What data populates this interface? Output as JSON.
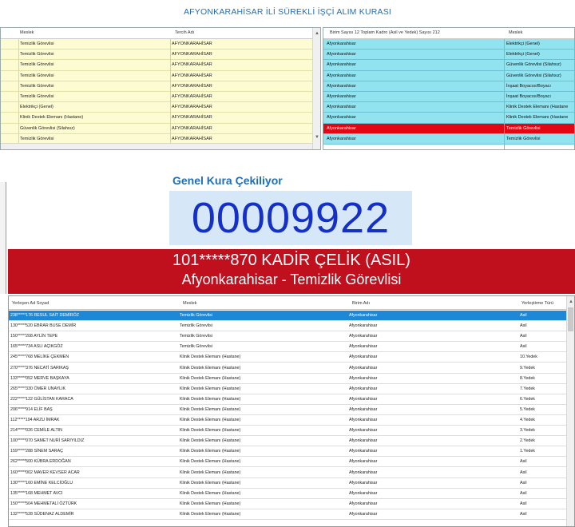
{
  "window_title": "AFYONKARAHİSAR İLİ SÜREKLİ İŞÇİ ALIM KURASI",
  "top_left_grid": {
    "headers": [
      "Meslek",
      "Tercih Adı"
    ],
    "rows": [
      [
        "Temizlik Görevlisi",
        "AFYONKARAHİSAR"
      ],
      [
        "Temizlik Görevlisi",
        "AFYONKARAHİSAR"
      ],
      [
        "Temizlik Görevlisi",
        "AFYONKARAHİSAR"
      ],
      [
        "Temizlik Görevlisi",
        "AFYONKARAHİSAR"
      ],
      [
        "Temizlik Görevlisi",
        "AFYONKARAHİSAR"
      ],
      [
        "Temizlik Görevlisi",
        "AFYONKARAHİSAR"
      ],
      [
        "Elektrikçi (Genel)",
        "AFYONKARAHİSAR"
      ],
      [
        "Klinik Destek Elemanı (Hastane)",
        "AFYONKARAHİSAR"
      ],
      [
        "Güvenlik Görevlisi (Silahsız)",
        "AFYONKARAHİSAR"
      ],
      [
        "Temizlik Görevlisi",
        "AFYONKARAHİSAR"
      ]
    ]
  },
  "top_right_grid": {
    "headers": [
      "Birim Sayısı 12 Toplam Kadro (Asil ve Yedek) Sayısı 212",
      "Meslek"
    ],
    "rows": [
      [
        "Afyonkarahisar",
        "Elektrikçi (Genel)"
      ],
      [
        "Afyonkarahisar",
        "Elektrikçi (Genel)"
      ],
      [
        "Afyonkarahisar",
        "Güvenlik Görevlisi (Silahsız)"
      ],
      [
        "Afyonkarahisar",
        "Güvenlik Görevlisi (Silahsız)"
      ],
      [
        "Afyonkarahisar",
        "İnşaat Boyacısı/Boyacı"
      ],
      [
        "Afyonkarahisar",
        "İnşaat Boyacısı/Boyacı"
      ],
      [
        "Afyonkarahisar",
        "Klinik Destek Elemanı (Hastane"
      ],
      [
        "Afyonkarahisar",
        "Klinik Destek Elemanı (Hastane"
      ],
      [
        "Afyonkarahisar",
        "Temizlik Görevlisi"
      ],
      [
        "Afyonkarahisar",
        "Temizlik Görevlisi"
      ]
    ],
    "highlight_index": 8
  },
  "draw": {
    "label": "Genel Kura Çekiliyor",
    "number": "00009922",
    "winner_line1": "101*****870 KADİR ÇELİK (ASIL)",
    "winner_line2": "Afyonkarahisar - Temizlik Görevlisi"
  },
  "results_grid": {
    "headers": [
      "Yerleşen Ad Soyad",
      "Meslek",
      "Birim Adı",
      "Yerleştirme Türü"
    ],
    "rows": [
      [
        "238*****176 RESUL SAİT DEMİRÖZ",
        "Temizlik Görevlisi",
        "Afyonkarahisar",
        "Asil"
      ],
      [
        "130*****520 EBRAR BUSE DEMİR",
        "Temizlik Görevlisi",
        "Afyonkarahisar",
        "Asil"
      ],
      [
        "150*****208 AYLİN TEPE",
        "Temizlik Görevlisi",
        "Afyonkarahisar",
        "Asil"
      ],
      [
        "165*****734 ASLI AÇIKGÖZ",
        "Temizlik Görevlisi",
        "Afyonkarahisar",
        "Asil"
      ],
      [
        "245*****768 MELİKE ÇEKMEN",
        "Klinik Destek Elemanı (Hastane)",
        "Afyonkarahisar",
        "10.Yedek"
      ],
      [
        "270*****376 NECATİ SARIKAŞ",
        "Klinik Destek Elemanı (Hastane)",
        "Afyonkarahisar",
        "9.Yedek"
      ],
      [
        "133*****052 MERVE BAŞKAYA",
        "Klinik Destek Elemanı (Hastane)",
        "Afyonkarahisar",
        "8.Yedek"
      ],
      [
        "265*****330 ÖMER UNAYLIK",
        "Klinik Destek Elemanı (Hastane)",
        "Afyonkarahisar",
        "7.Yedek"
      ],
      [
        "222*****122 GÜLİSTAN KARACA",
        "Klinik Destek Elemanı (Hastane)",
        "Afyonkarahisar",
        "6.Yedek"
      ],
      [
        "206*****914 ELİF BAŞ",
        "Klinik Destek Elemanı (Hastane)",
        "Afyonkarahisar",
        "5.Yedek"
      ],
      [
        "112*****194 ARZU İMRAK",
        "Klinik Destek Elemanı (Hastane)",
        "Afyonkarahisar",
        "4.Yedek"
      ],
      [
        "214*****026 CEMİLE ALTIN",
        "Klinik Destek Elemanı (Hastane)",
        "Afyonkarahisar",
        "3.Yedek"
      ],
      [
        "100*****070 SAMET NURİ SARIYILDIZ",
        "Klinik Destek Elemanı (Hastane)",
        "Afyonkarahisar",
        "2.Yedek"
      ],
      [
        "159*****288 SİNEM SARAÇ",
        "Klinik Destek Elemanı (Hastane)",
        "Afyonkarahisar",
        "1.Yedek"
      ],
      [
        "262*****500 KÜBRA ERDOĞAN",
        "Klinik Destek Elemanı (Hastane)",
        "Afyonkarahisar",
        "Asil"
      ],
      [
        "160*****002 MAVER KEVSER ACAR",
        "Klinik Destek Elemanı (Hastane)",
        "Afyonkarahisar",
        "Asil"
      ],
      [
        "130*****160 EMİNE KELCİOĞLU",
        "Klinik Destek Elemanı (Hastane)",
        "Afyonkarahisar",
        "Asil"
      ],
      [
        "135*****168 MEHMET AVCI",
        "Klinik Destek Elemanı (Hastane)",
        "Afyonkarahisar",
        "Asil"
      ],
      [
        "150*****504 MEHMETALİ ÖZTÜRK",
        "Klinik Destek Elemanı (Hastane)",
        "Afyonkarahisar",
        "Asil"
      ],
      [
        "132*****528 SÜDENAZ ALDEMİR",
        "Klinik Destek Elemanı (Hastane)",
        "Afyonkarahisar",
        "Asil"
      ]
    ],
    "selected_index": 0
  },
  "colors": {
    "title_blue": "#1f6fb8",
    "yellow_row": "#fdfbd2",
    "cyan_row": "#92e3f0",
    "highlight_red": "#e30613",
    "banner_red": "#c0101e",
    "counter_blue": "#1530c6",
    "selected_row": "#1e88d6"
  }
}
